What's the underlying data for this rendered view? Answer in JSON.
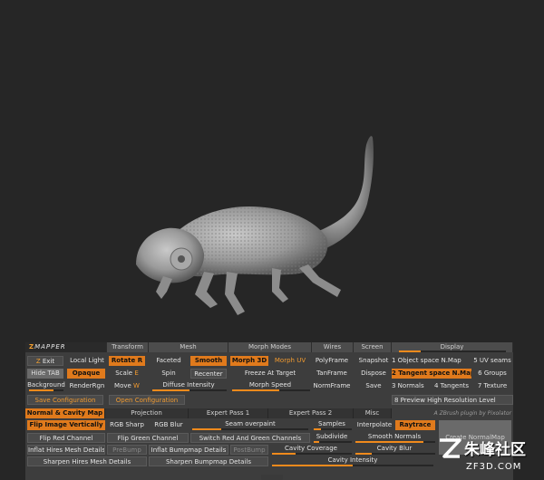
{
  "header": {
    "logo_z": "Z",
    "logo_rest": "MAPPER",
    "sections": [
      "Transform",
      "Mesh",
      "Morph Modes",
      "Wires",
      "Screen",
      "Display"
    ]
  },
  "buttons": {
    "exit": "Exit",
    "local_light": "Local Light",
    "rotate": "Rotate",
    "rotate_key": "R",
    "faceted": "Faceted",
    "smooth": "Smooth",
    "morph_3d": "Morph 3D",
    "morph_uv": "Morph UV",
    "polyframe": "PolyFrame",
    "snapshot": "Snapshot",
    "object_space": "1 Object space N.Map",
    "uv_seams": "5 UV seams",
    "hide_tab": "Hide TAB",
    "opaque": "Opaque",
    "scale": "Scale",
    "scale_key": "E",
    "spin": "Spin",
    "recenter": "Recenter",
    "freeze_at_target": "Freeze At Target",
    "tanframe": "TanFrame",
    "dispose": "Dispose",
    "tangent_space": "2 Tangent space N.Map",
    "groups": "6 Groups",
    "background": "Background",
    "renderrgn": "RenderRgn",
    "move": "Move",
    "move_key": "W",
    "diffuse_intensity": "Diffuse Intensity",
    "morph_speed": "Morph Speed",
    "normframe": "NormFrame",
    "save": "Save",
    "normals": "3 Normals",
    "tangents": "4 Tangents",
    "texture": "7 Texture",
    "save_configuration": "Save Configuration",
    "open_configuration": "Open Configuration",
    "preview_high_res": "8 Preview High Resolution Level"
  },
  "tabs": [
    "Normal & Cavity Map",
    "Projection",
    "Expert Pass 1",
    "Expert Pass 2",
    "Misc"
  ],
  "credit": "A ZBrush plugin by Pixolator",
  "panel": {
    "flip_image_vertically": "Flip Image Vertically",
    "rgb_sharp": "RGB Sharp",
    "rgb_blur": "RGB Blur",
    "seam_overpaint": "Seam overpaint",
    "samples": "Samples",
    "interpolate": "Interpolate",
    "raytrace": "Raytrace",
    "flip_red_channel": "Flip Red Channel",
    "flip_green_channel": "Flip Green Channel",
    "switch_red_green": "Switch Red And Green Channels",
    "subdivide": "Subdivide",
    "smooth_normals": "Smooth Normals",
    "create_normalmap": "Create NormalMap",
    "inflat_hires": "Inflat Hires Mesh Details",
    "prebump": "PreBump",
    "inflat_bumpmap": "Inflat Bumpmap Details",
    "postbump": "PostBump",
    "cavity_coverage": "Cavity Coverage",
    "cavity_blur": "Cavity Blur",
    "sharpen_hires": "Sharpen Hires Mesh Details",
    "sharpen_bumpmap": "Sharpen Bumpmap Details",
    "cavity_intensity": "Cavity Intensity"
  },
  "sliders": {
    "display": 0.2,
    "background": 0.7,
    "diffuse_intensity": 0.5,
    "morph_speed": 0.6,
    "seam_overpaint": 0.25,
    "samples": 0.2,
    "subdivide": 0.15,
    "smooth_normals": 0.85,
    "cavity_coverage": 0.3,
    "cavity_blur": 0.2,
    "cavity_intensity": 0.5
  },
  "watermark": {
    "title": "朱峰社区",
    "subtitle": "ZF3D.COM"
  },
  "colors": {
    "accent": "#e07a1c",
    "panel": "#3d3d3d",
    "viewport": "#262626"
  },
  "icons": {
    "z_brush_logo": "z-logo-icon",
    "watermark_logo": "zf-logo-icon",
    "model": "chameleon-3d-model"
  }
}
